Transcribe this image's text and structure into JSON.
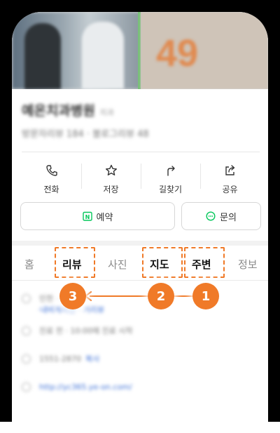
{
  "hero": {
    "photo_number": "49"
  },
  "place": {
    "name": "예온치과병원",
    "category": "치과",
    "address_line": "방문자리뷰 184 · 블로그리뷰 48"
  },
  "actions": [
    {
      "label": "전화",
      "icon": "phone-icon"
    },
    {
      "label": "저장",
      "icon": "star-icon"
    },
    {
      "label": "길찾기",
      "icon": "directions-icon"
    },
    {
      "label": "공유",
      "icon": "share-icon"
    }
  ],
  "buttons": {
    "reserve": "예약",
    "reserve_icon_letter": "N",
    "inquiry": "문의"
  },
  "tabs": {
    "home": "홈",
    "review": "리뷰",
    "photo": "사진",
    "map": "지도",
    "nearby": "주변",
    "info": "정보"
  },
  "badges": {
    "b1": "1",
    "b2": "2",
    "b3": "3"
  },
  "details": {
    "address": "인천 ···· ····· ···",
    "address_sub": "·내비게이션 · 거리뷰",
    "hours": "진료 전 · 10:00에 진료 시작",
    "phone": "1551-2870",
    "phone_link": "복사",
    "url": "http://yc365.ye-on.com/"
  },
  "colors": {
    "accent": "#f07a28",
    "naver_green": "#03c75a",
    "link_blue": "#3b6fd6"
  }
}
